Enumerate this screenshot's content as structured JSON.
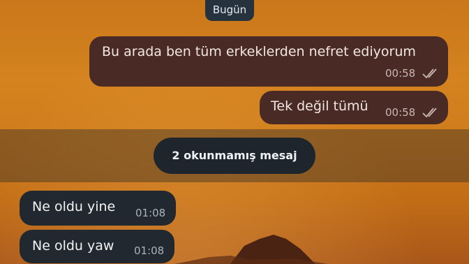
{
  "date_separator": "Bugün",
  "messages": [
    {
      "direction": "outgoing",
      "text": "Bu arada ben tüm erkeklerden nefret ediyorum",
      "time": "00:58",
      "status": "read"
    },
    {
      "direction": "outgoing",
      "text": "Tek değil tümü",
      "time": "00:58",
      "status": "read"
    },
    {
      "direction": "incoming",
      "text": "Ne oldu yine",
      "time": "01:08"
    },
    {
      "direction": "incoming",
      "text": "Ne oldu yaw",
      "time": "01:08"
    }
  ],
  "unread_banner": "2 okunmamış mesaj",
  "colors": {
    "outgoing_bubble": "#4a2a24",
    "incoming_bubble": "#22282f",
    "banner": "#1e252c",
    "wallpaper": "#cf7b1c"
  },
  "icons": {
    "read_receipt": "double-check-icon"
  }
}
